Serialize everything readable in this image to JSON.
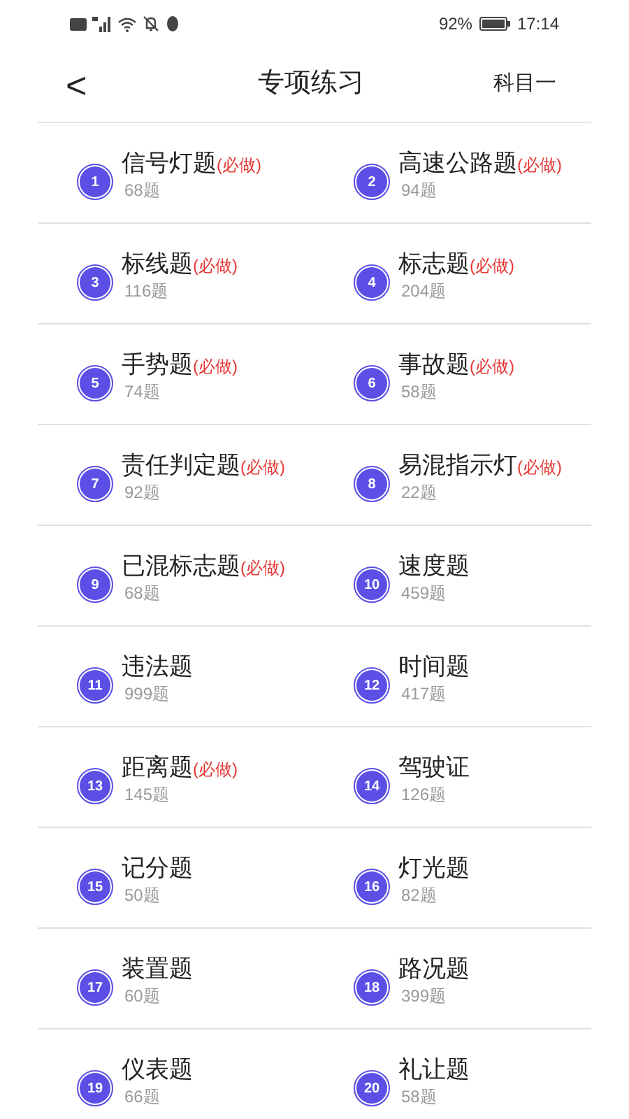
{
  "status_bar": {
    "battery": "92%",
    "time": "17:14"
  },
  "header": {
    "back": "<",
    "title": "专项练习",
    "subject": "科目一"
  },
  "items": [
    {
      "number": "1",
      "name": "信号灯题",
      "badge": "(必做)",
      "count": "68题"
    },
    {
      "number": "2",
      "name": "高速公路题",
      "badge": "(必做)",
      "count": "94题"
    },
    {
      "number": "3",
      "name": "标线题",
      "badge": "(必做)",
      "count": "116题"
    },
    {
      "number": "4",
      "name": "标志题",
      "badge": "(必做)",
      "count": "204题"
    },
    {
      "number": "5",
      "name": "手势题",
      "badge": "(必做)",
      "count": "74题"
    },
    {
      "number": "6",
      "name": "事故题",
      "badge": "(必做)",
      "count": "58题"
    },
    {
      "number": "7",
      "name": "责任判定题",
      "badge": "(必做)",
      "count": "92题"
    },
    {
      "number": "8",
      "name": "易混指示灯",
      "badge": "(必做)",
      "count": "22题"
    },
    {
      "number": "9",
      "name": "已混标志题",
      "badge": "(必做)",
      "count": "68题"
    },
    {
      "number": "10",
      "name": "速度题",
      "count": "459题"
    },
    {
      "number": "11",
      "name": "违法题",
      "count": "999题"
    },
    {
      "number": "12",
      "name": "时间题",
      "count": "417题"
    },
    {
      "number": "13",
      "name": "距离题",
      "badge": "(必做)",
      "count": "145题"
    },
    {
      "number": "14",
      "name": "驾驶证",
      "count": "126题"
    },
    {
      "number": "15",
      "name": "记分题",
      "count": "50题"
    },
    {
      "number": "16",
      "name": "灯光题",
      "count": "82题"
    },
    {
      "number": "17",
      "name": "装置题",
      "count": "60题"
    },
    {
      "number": "18",
      "name": "路况题",
      "count": "399题"
    },
    {
      "number": "19",
      "name": "仪表题",
      "count": "66题"
    },
    {
      "number": "20",
      "name": "礼让题",
      "count": "58题"
    }
  ]
}
